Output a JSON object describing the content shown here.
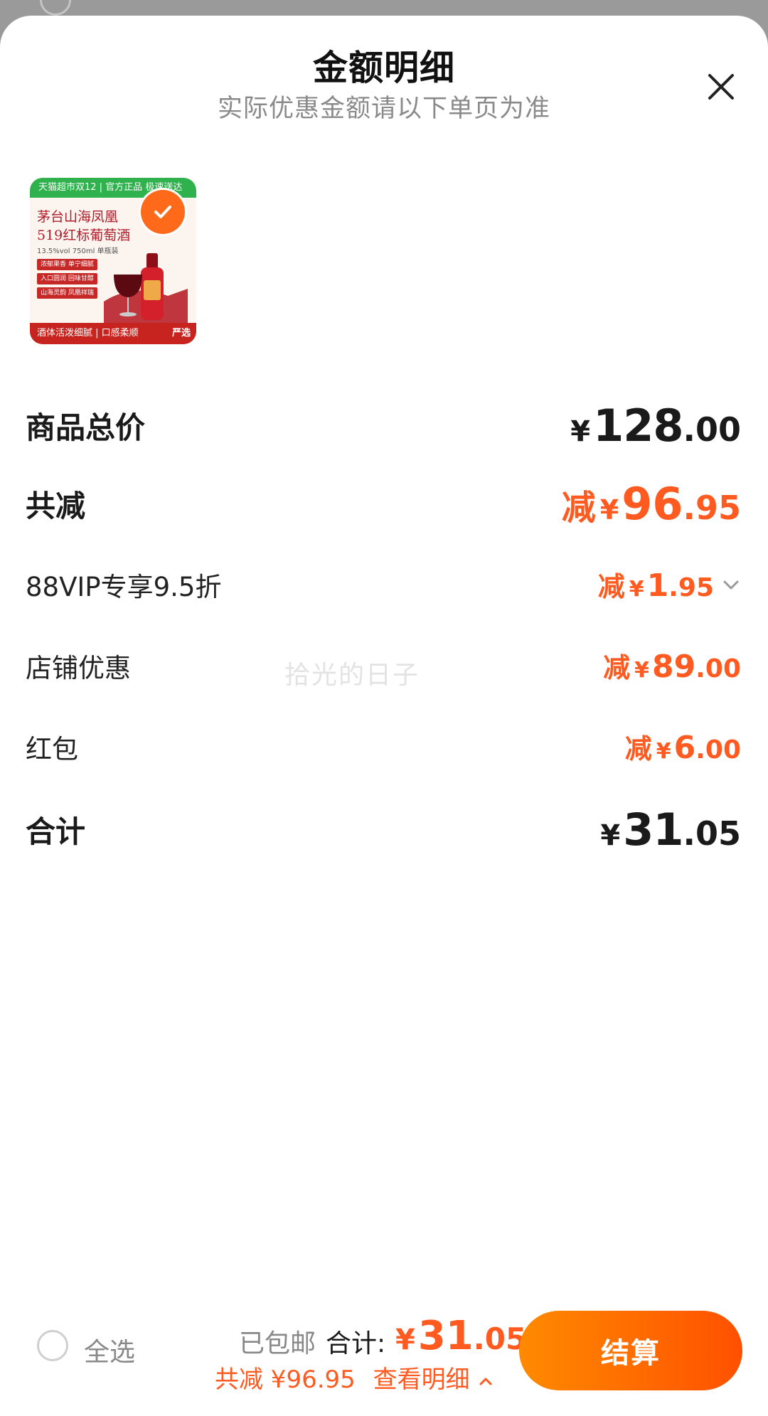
{
  "sheet": {
    "title": "金额明细",
    "subtitle": "实际优惠金额请以下单页为准"
  },
  "product": {
    "banner_text": "天猫超市双12 | 官方正品 极速送达",
    "name_line1": "茅台山海凤凰",
    "name_line2": "519红标葡萄酒",
    "spec": "13.5%vol 750ml 单瓶装",
    "tags": [
      "浓郁果香 单宁细腻",
      "入口圆润 回味甘醇",
      "山海灵韵 凤凰祥瑞"
    ],
    "footer_text": "酒体活泼细腻 | 口感柔顺",
    "footer_badge": "严选",
    "selected": true
  },
  "breakdown": {
    "total_price": {
      "label": "商品总价",
      "currency": "¥",
      "int": "128",
      "dec": ".00"
    },
    "total_discount": {
      "label": "共减",
      "prefix": "减",
      "currency": "¥",
      "int": "96",
      "dec": ".95"
    },
    "items": [
      {
        "label": "88VIP专享9.5折",
        "prefix": "减",
        "currency": "¥",
        "int": "1",
        "dec": ".95",
        "expandable": true
      },
      {
        "label": "店铺优惠",
        "prefix": "减",
        "currency": "¥",
        "int": "89",
        "dec": ".00"
      },
      {
        "label": "红包",
        "prefix": "减",
        "currency": "¥",
        "int": "6",
        "dec": ".00"
      }
    ],
    "subtotal": {
      "label": "合计",
      "currency": "¥",
      "int": "31",
      "dec": ".05"
    }
  },
  "watermark": "拾光的日子",
  "bottom_bar": {
    "select_all_label": "全选",
    "shipping": "已包邮",
    "total_label": "合计:",
    "total_currency": "¥",
    "total_int": "31",
    "total_dec": ".05",
    "discount_summary": "共减 ¥96.95",
    "detail_link": "查看明细",
    "checkout_label": "结算"
  },
  "colors": {
    "accent": "#ff5a1f",
    "checkout_gradient_start": "#ff8a00",
    "checkout_gradient_end": "#ff5000"
  }
}
